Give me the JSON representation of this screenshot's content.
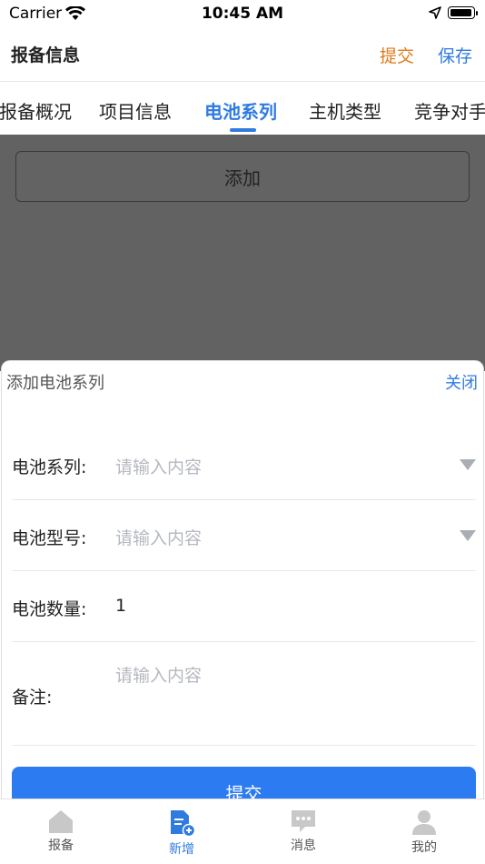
{
  "status_bar": {
    "carrier": "Carrier",
    "time": "10:45 AM"
  },
  "header": {
    "title": "报备信息",
    "submit_label": "提交",
    "save_label": "保存"
  },
  "tabs": [
    {
      "label": "报备概况",
      "active": false
    },
    {
      "label": "项目信息",
      "active": false
    },
    {
      "label": "电池系列",
      "active": true
    },
    {
      "label": "主机类型",
      "active": false
    },
    {
      "label": "竞争对手",
      "active": false
    }
  ],
  "main": {
    "add_label": "添加"
  },
  "sheet": {
    "title": "添加电池系列",
    "close_label": "关闭",
    "fields": {
      "battery_series": {
        "label": "电池系列:",
        "placeholder": "请输入内容"
      },
      "battery_model": {
        "label": "电池型号:",
        "placeholder": "请输入内容"
      },
      "battery_qty": {
        "label": "电池数量:",
        "value": "1"
      },
      "remark": {
        "label": "备注:",
        "placeholder": "请输入内容"
      }
    },
    "submit_label": "提交"
  },
  "tabbar": [
    {
      "label": "报备",
      "icon": "house-icon",
      "active": false
    },
    {
      "label": "新增",
      "icon": "document-add-icon",
      "active": true
    },
    {
      "label": "消息",
      "icon": "chat-bubble-icon",
      "active": false
    },
    {
      "label": "我的",
      "icon": "person-icon",
      "active": false
    }
  ],
  "colors": {
    "accent": "#2f7be0",
    "submit_orange": "#e07a18",
    "overlay": "#626262",
    "button_blue": "#2d7bf0"
  }
}
